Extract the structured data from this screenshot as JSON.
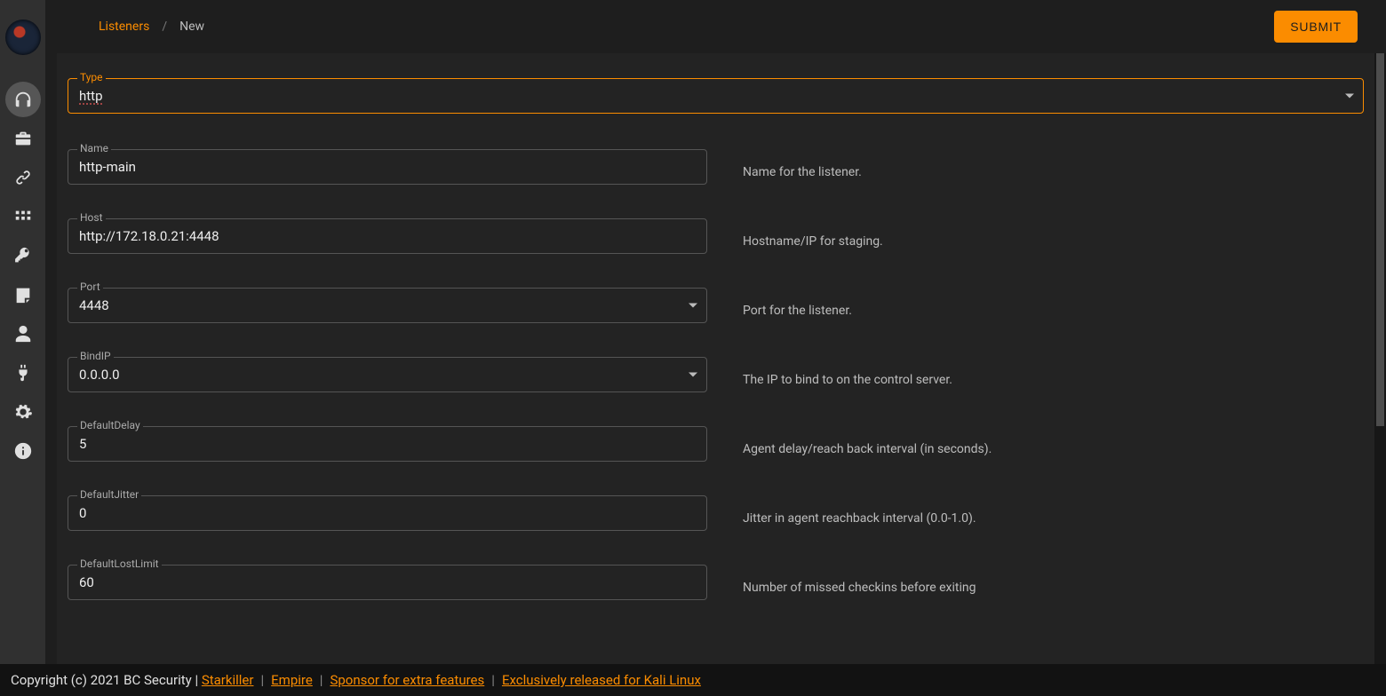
{
  "breadcrumb": {
    "root": "Listeners",
    "current": "New"
  },
  "submit_label": "SUBMIT",
  "type_field": {
    "label": "Type",
    "value": "http"
  },
  "fields": [
    {
      "label": "Name",
      "value": "http-main",
      "desc": "Name for the listener.",
      "dropdown": false
    },
    {
      "label": "Host",
      "value": "http://172.18.0.21:4448",
      "desc": "Hostname/IP for staging.",
      "dropdown": false
    },
    {
      "label": "Port",
      "value": "4448",
      "desc": "Port for the listener.",
      "dropdown": true
    },
    {
      "label": "BindIP",
      "value": "0.0.0.0",
      "desc": "The IP to bind to on the control server.",
      "dropdown": true
    },
    {
      "label": "DefaultDelay",
      "value": "5",
      "desc": "Agent delay/reach back interval (in seconds).",
      "dropdown": false
    },
    {
      "label": "DefaultJitter",
      "value": "0",
      "desc": "Jitter in agent reachback interval (0.0-1.0).",
      "dropdown": false
    },
    {
      "label": "DefaultLostLimit",
      "value": "60",
      "desc": "Number of missed checkins before exiting",
      "dropdown": false
    }
  ],
  "footer": {
    "copyright": "Copyright (c) 2021 BC Security",
    "links": [
      "Starkiller",
      "Empire",
      "Sponsor for extra features",
      "Exclusively released for Kali Linux"
    ]
  },
  "sidebar": {
    "items": [
      {
        "name": "listeners",
        "icon": "headphones",
        "active": true
      },
      {
        "name": "stagers",
        "icon": "briefcase",
        "active": false
      },
      {
        "name": "agents",
        "icon": "link",
        "active": false
      },
      {
        "name": "modules",
        "icon": "grid",
        "active": false
      },
      {
        "name": "credentials",
        "icon": "key",
        "active": false
      },
      {
        "name": "reporting",
        "icon": "note",
        "active": false
      },
      {
        "name": "users",
        "icon": "user",
        "active": false
      },
      {
        "name": "plugins",
        "icon": "plug",
        "active": false
      },
      {
        "name": "settings",
        "icon": "gear",
        "active": false
      },
      {
        "name": "about",
        "icon": "info",
        "active": false
      }
    ]
  }
}
